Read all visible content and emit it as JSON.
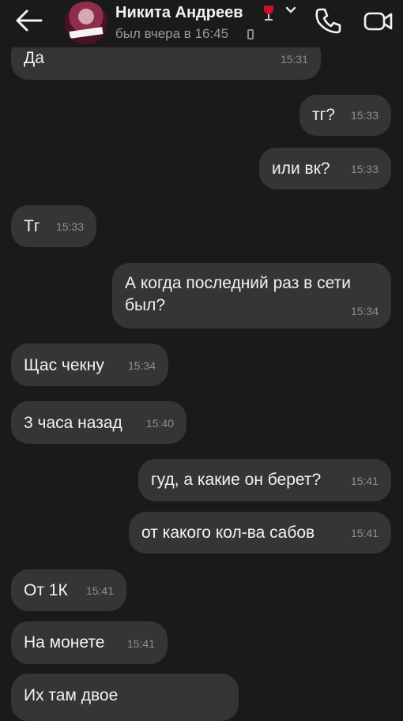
{
  "header": {
    "contact_name": "Никита Андреев",
    "status": "был вчера в 16:45"
  },
  "messages": [
    {
      "text": "Да",
      "time": "15:31",
      "side": "in"
    },
    {
      "text": "тг?",
      "time": "15:33",
      "side": "out"
    },
    {
      "text": "или вк?",
      "time": "15:33",
      "side": "out"
    },
    {
      "text": "Тг",
      "time": "15:33",
      "side": "in"
    },
    {
      "text": "А когда последний раз в сети был?",
      "time": "15:34",
      "side": "out"
    },
    {
      "text": "Щас чекну",
      "time": "15:34",
      "side": "in"
    },
    {
      "text": "3 часа назад",
      "time": "15:40",
      "side": "in"
    },
    {
      "text": "гуд, а какие он берет?",
      "time": "15:41",
      "side": "out"
    },
    {
      "text": "от какого кол-ва сабов",
      "time": "15:41",
      "side": "out"
    },
    {
      "text": "От 1К",
      "time": "15:41",
      "side": "in"
    },
    {
      "text": "На монете",
      "time": "15:41",
      "side": "in"
    },
    {
      "text": "Их там двое",
      "time": "",
      "side": "in"
    }
  ],
  "icons": {
    "back": "arrow-left-icon",
    "call": "phone-icon",
    "video": "video-camera-icon",
    "emoji": "wine-glass-icon",
    "chevron": "chevron-down-icon",
    "online_device": "mobile-phone-icon"
  },
  "colors": {
    "background": "#1a1a1a",
    "bubble": "#353535",
    "text": "#f2f2f2",
    "timestamp": "#8e8e8e",
    "status": "#9a9a9a"
  }
}
